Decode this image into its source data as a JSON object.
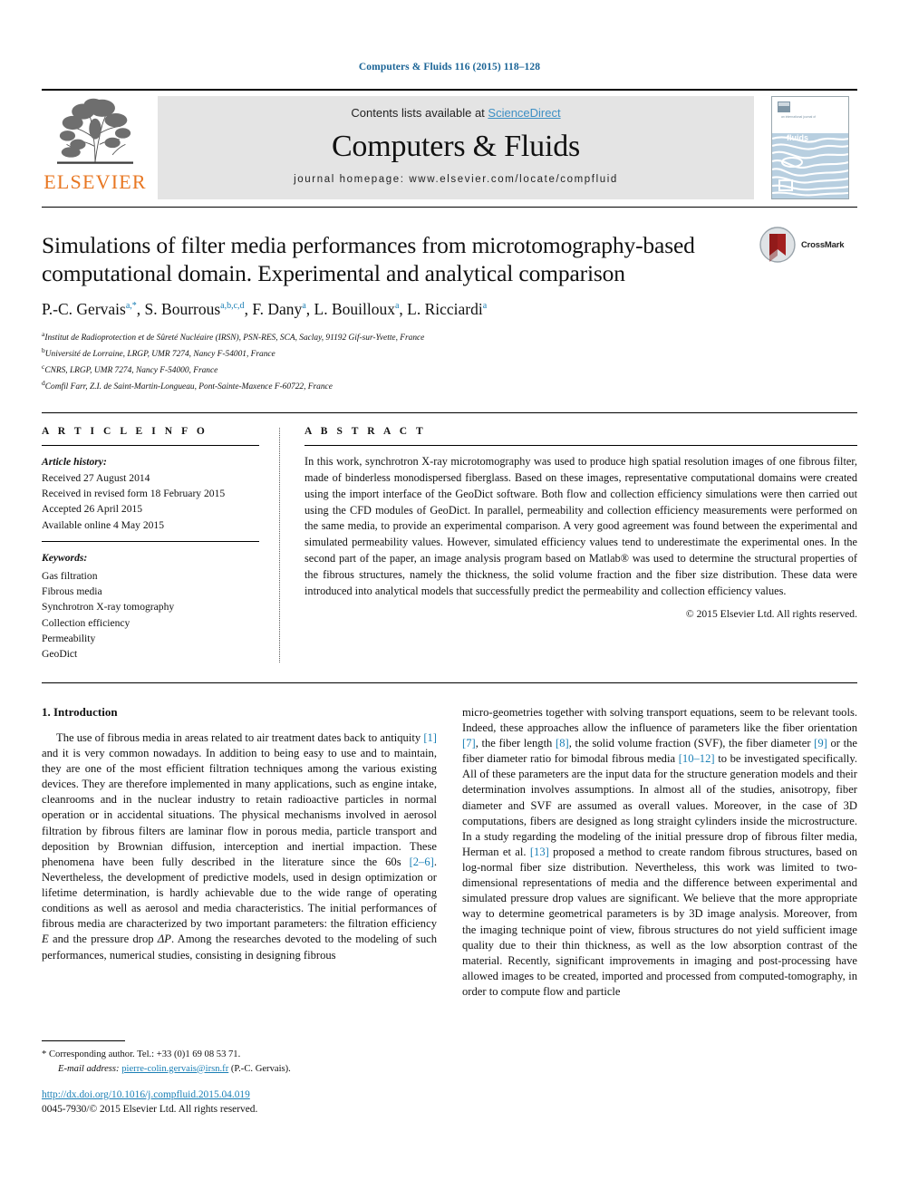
{
  "running_head": "Computers & Fluids 116 (2015) 118–128",
  "masthead": {
    "publisher_name": "ELSEVIER",
    "contents_text": "Contents lists available at ",
    "sciencedirect_label": "ScienceDirect",
    "journal_title": "Computers & Fluids",
    "homepage_label": "journal homepage: www.elsevier.com/locate/compfluid",
    "cover_lines": [
      "an international journal",
      "computers",
      "&",
      "fluids"
    ],
    "link_color": "#3d8fc4"
  },
  "title_block": {
    "title": "Simulations of filter media performances from microtomography-based computational domain. Experimental and analytical comparison",
    "crossmark_label": "CrossMark",
    "authors": [
      {
        "name": "P.-C. Gervais",
        "marks": "a,*"
      },
      {
        "name": "S. Bourrous",
        "marks": "a,b,c,d"
      },
      {
        "name": "F. Dany",
        "marks": "a"
      },
      {
        "name": "L. Bouilloux",
        "marks": "a"
      },
      {
        "name": "L. Ricciardi",
        "marks": "a"
      }
    ],
    "affiliations": [
      {
        "mark": "a",
        "text": "Institut de Radioprotection et de Sûreté Nucléaire (IRSN), PSN-RES, SCA, Saclay, 91192 Gif-sur-Yvette, France"
      },
      {
        "mark": "b",
        "text": "Université de Lorraine, LRGP, UMR 7274, Nancy F-54001, France"
      },
      {
        "mark": "c",
        "text": "CNRS, LRGP, UMR 7274, Nancy F-54000, France"
      },
      {
        "mark": "d",
        "text": "Comfil Farr, Z.I. de Saint-Martin-Longueau, Pont-Sainte-Maxence F-60722, France"
      }
    ]
  },
  "article_info": {
    "heading": "A R T I C L E    I N F O",
    "history_label": "Article history:",
    "history": [
      "Received 27 August 2014",
      "Received in revised form 18 February 2015",
      "Accepted 26 April 2015",
      "Available online 4 May 2015"
    ],
    "keywords_label": "Keywords:",
    "keywords": [
      "Gas filtration",
      "Fibrous media",
      "Synchrotron X-ray tomography",
      "Collection efficiency",
      "Permeability",
      "GeoDict"
    ]
  },
  "abstract": {
    "heading": "A B S T R A C T",
    "text": "In this work, synchrotron X-ray microtomography was used to produce high spatial resolution images of one fibrous filter, made of binderless monodispersed fiberglass. Based on these images, representative computational domains were created using the import interface of the GeoDict software. Both flow and collection efficiency simulations were then carried out using the CFD modules of GeoDict. In parallel, permeability and collection efficiency measurements were performed on the same media, to provide an experimental comparison. A very good agreement was found between the experimental and simulated permeability values. However, simulated efficiency values tend to underestimate the experimental ones. In the second part of the paper, an image analysis program based on Matlab® was used to determine the structural properties of the fibrous structures, namely the thickness, the solid volume fraction and the fiber size distribution. These data were introduced into analytical models that successfully predict the permeability and collection efficiency values.",
    "copyright": "© 2015 Elsevier Ltd. All rights reserved."
  },
  "introduction": {
    "section_title": "1. Introduction",
    "left_paragraph_1": "The use of fibrous media in areas related to air treatment dates back to antiquity [1] and it is very common nowadays. In addition to being easy to use and to maintain, they are one of the most efficient filtration techniques among the various existing devices. They are therefore implemented in many applications, such as engine intake, cleanrooms and in the nuclear industry to retain radioactive particles in normal operation or in accidental situations. The physical mechanisms involved in aerosol filtration by fibrous filters are laminar flow in porous media, particle transport and deposition by Brownian diffusion, interception and inertial impaction. These phenomena have been fully described in the literature since the 60s [2–6]. Nevertheless, the development of predictive models, used in design optimization or lifetime determination, is hardly achievable due to the wide range of operating conditions as well as aerosol and media characteristics. The initial performances of fibrous media are characterized by two important parameters: the filtration efficiency E and the pressure drop ΔP. Among the researches devoted to the modeling of such performances, numerical studies, consisting in designing fibrous",
    "right_paragraph_1": "micro-geometries together with solving transport equations, seem to be relevant tools. Indeed, these approaches allow the influence of parameters like the fiber orientation [7], the fiber length [8], the solid volume fraction (SVF), the fiber diameter [9] or the fiber diameter ratio for bimodal fibrous media [10–12] to be investigated specifically. All of these parameters are the input data for the structure generation models and their determination involves assumptions. In almost all of the studies, anisotropy, fiber diameter and SVF are assumed as overall values. Moreover, in the case of 3D computations, fibers are designed as long straight cylinders inside the microstructure. In a study regarding the modeling of the initial pressure drop of fibrous filter media, Herman et al. [13] proposed a method to create random fibrous structures, based on log-normal fiber size distribution. Nevertheless, this work was limited to two-dimensional representations of media and the difference between experimental and simulated pressure drop values are significant. We believe that the more appropriate way to determine geometrical parameters is by 3D image analysis. Moreover, from the imaging technique point of view, fibrous structures do not yield sufficient image quality due to their thin thickness, as well as the low absorption contrast of the material. Recently, significant improvements in imaging and post-processing have allowed images to be created, imported and processed from computed-tomography, in order to compute flow and particle"
  },
  "footnote": {
    "corresponding_mark": "*",
    "corresponding_text": "Corresponding author. Tel.: +33 (0)1 69 08 53 71.",
    "email_label": "E-mail address:",
    "email": "pierre-colin.gervais@irsn.fr",
    "email_owner": "(P.-C. Gervais).",
    "doi_url": "http://dx.doi.org/10.1016/j.compfluid.2015.04.019",
    "issn_line": "0045-7930/© 2015 Elsevier Ltd. All rights reserved."
  }
}
